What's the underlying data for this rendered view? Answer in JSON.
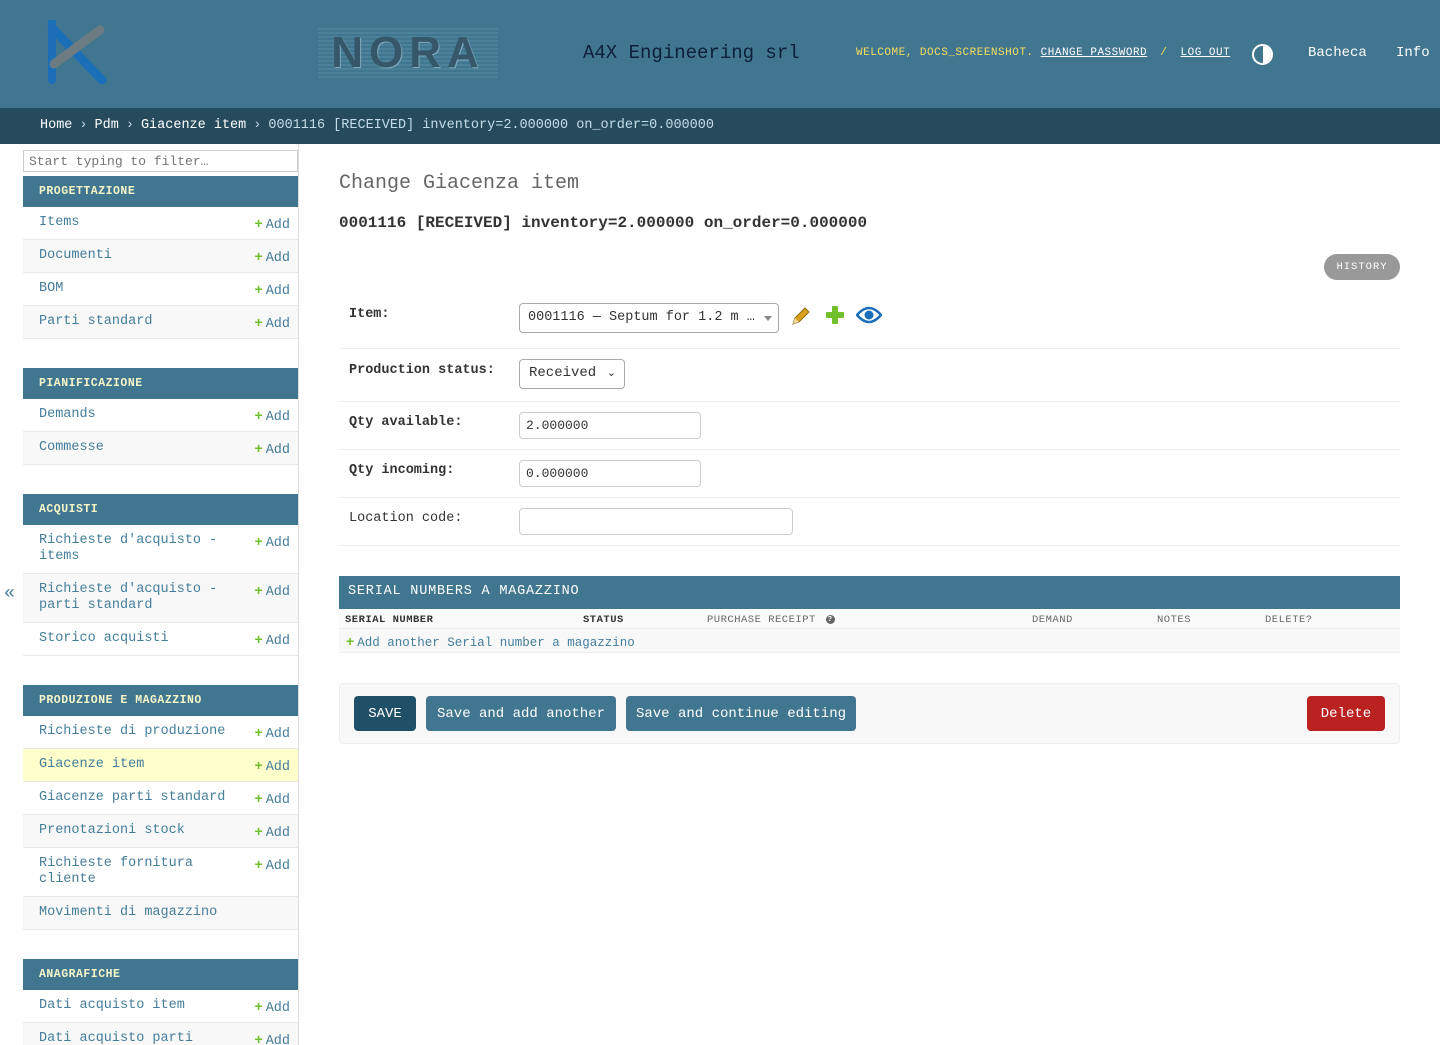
{
  "header": {
    "logo_icon": "a4x-logo-icon",
    "nora_logo_text": "NORA",
    "company": "A4X Engineering srl",
    "welcome": "WELCOME, DOCS_SCREENSHOT.",
    "change_password": "CHANGE PASSWORD",
    "separator": "/",
    "log_out": "LOG OUT",
    "theme_icon": "theme-toggle-icon",
    "links": [
      "Bacheca",
      "Info"
    ]
  },
  "breadcrumbs": {
    "items": [
      "Home",
      "Pdm",
      "Giacenze item"
    ],
    "separator": "›",
    "current": "0001116 [RECEIVED] inventory=2.000000 on_order=0.000000"
  },
  "sidebar": {
    "filter_placeholder": "Start typing to filter…",
    "add_label": "Add",
    "collapse_label": "«",
    "apps": [
      {
        "caption": "PROGETTAZIONE",
        "models": [
          {
            "label": "Items",
            "add": true
          },
          {
            "label": "Documenti",
            "add": true
          },
          {
            "label": "BOM",
            "add": true
          },
          {
            "label": "Parti standard",
            "add": true
          }
        ]
      },
      {
        "caption": "PIANIFICAZIONE",
        "models": [
          {
            "label": "Demands",
            "add": true
          },
          {
            "label": "Commesse",
            "add": true
          }
        ]
      },
      {
        "caption": "ACQUISTI",
        "models": [
          {
            "label": "Richieste d'acquisto - items",
            "add": true
          },
          {
            "label": "Richieste d'acquisto - parti standard",
            "add": true
          },
          {
            "label": "Storico acquisti",
            "add": true
          }
        ]
      },
      {
        "caption": "PRODUZIONE E MAGAZZINO",
        "models": [
          {
            "label": "Richieste di produzione",
            "add": true
          },
          {
            "label": "Giacenze item",
            "add": true,
            "current": true
          },
          {
            "label": "Giacenze parti standard",
            "add": true
          },
          {
            "label": "Prenotazioni stock",
            "add": true
          },
          {
            "label": "Richieste fornitura cliente",
            "add": true
          },
          {
            "label": "Movimenti di magazzino",
            "add": false
          }
        ]
      },
      {
        "caption": "ANAGRAFICHE",
        "models": [
          {
            "label": "Dati acquisto item",
            "add": true
          },
          {
            "label": "Dati acquisto parti",
            "add": true
          }
        ]
      }
    ]
  },
  "main": {
    "title": "Change Giacenza item",
    "object_title": "0001116 [RECEIVED] inventory=2.000000 on_order=0.000000",
    "history": "HISTORY",
    "fields": {
      "item_label": "Item:",
      "item_value": "0001116 — Septum for 1.2 m …",
      "status_label": "Production status:",
      "status_value": "Received",
      "qty_available_label": "Qty available:",
      "qty_available_value": "2.000000",
      "qty_incoming_label": "Qty incoming:",
      "qty_incoming_value": "0.000000",
      "location_label": "Location code:",
      "location_value": ""
    },
    "inline": {
      "caption": "SERIAL NUMBERS A MAGAZZINO",
      "columns": [
        "SERIAL NUMBER",
        "STATUS",
        "PURCHASE RECEIPT",
        "DEMAND",
        "NOTES",
        "DELETE?"
      ],
      "help_icon": "question-circle-icon",
      "add_another": "Add another Serial number a magazzino"
    },
    "buttons": {
      "save": "SAVE",
      "save_add": "Save and add another",
      "save_continue": "Save and continue editing",
      "delete": "Delete"
    }
  },
  "colors": {
    "header": "#417690",
    "breadcrumbs": "#264b5d",
    "accent_yellow": "#f5dd5d",
    "delete": "#ba2121",
    "current_row": "#ffffcc",
    "link": "#447e9b",
    "add_plus": "#70bf2b"
  }
}
